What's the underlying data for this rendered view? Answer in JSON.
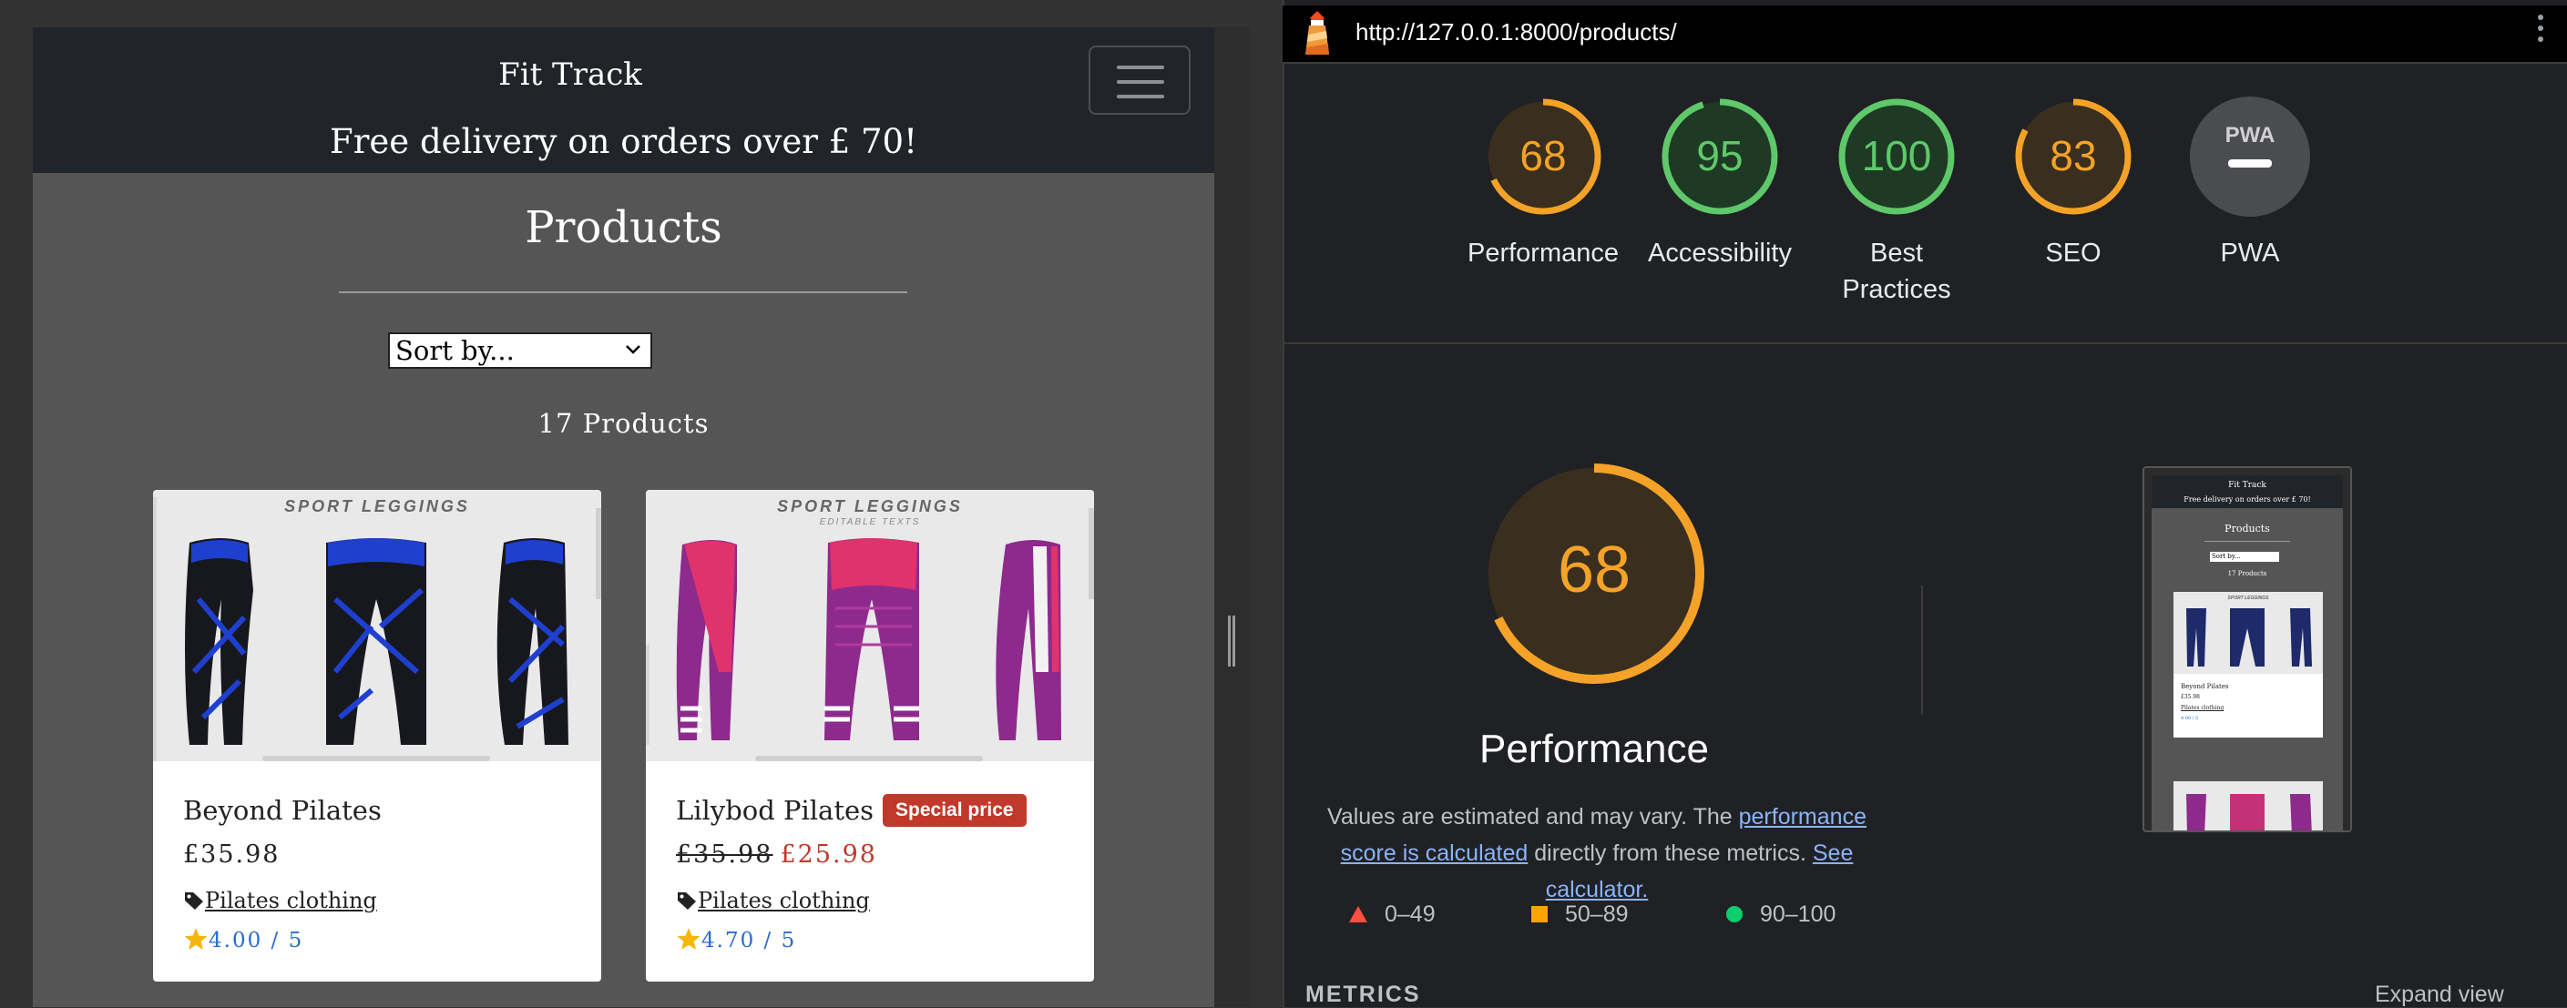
{
  "site": {
    "brand": "Fit Track",
    "delivery_banner": "Free delivery on orders over £ 70!",
    "page_title": "Products",
    "sort_placeholder": "Sort by...",
    "product_count": "17 Products",
    "products": [
      {
        "name": "Beyond Pilates",
        "banner": "SPORT LEGGINGS",
        "banner_sub": "",
        "price": "£35.98",
        "old_price": "",
        "badge": "",
        "category": "Pilates clothing",
        "rating": "4.00 / 5",
        "color_primary": "#1f3fcf",
        "color_secondary": "#17181d"
      },
      {
        "name": "Lilybod Pilates",
        "banner": "SPORT LEGGINGS",
        "banner_sub": "EDITABLE TEXTS",
        "price": "£25.98",
        "old_price": "£35.98",
        "badge": "Special price",
        "category": "Pilates clothing",
        "rating": "4.70 / 5",
        "color_primary": "#8e2a8c",
        "color_secondary": "#e0336d"
      }
    ]
  },
  "lighthouse": {
    "url": "http://127.0.0.1:8000/products/",
    "gauges": [
      {
        "label": "Performance",
        "score": "68",
        "value": 68,
        "color": "#f4a328"
      },
      {
        "label": "Accessibility",
        "score": "95",
        "value": 95,
        "color": "#5fc86a"
      },
      {
        "label": "Best Practices",
        "score": "100",
        "value": 100,
        "color": "#5fc86a"
      },
      {
        "label": "SEO",
        "score": "83",
        "value": 83,
        "color": "#f4a328"
      },
      {
        "label": "PWA",
        "score": "",
        "value": 0,
        "color": "#9aa0a6"
      }
    ],
    "big_score": "68",
    "big_score_value": 68,
    "big_label": "Performance",
    "estimate_pre": "Values are estimated and may vary. The ",
    "estimate_link": "performance score is calculated",
    "estimate_mid": " directly from these metrics. ",
    "calculator_link": "See calculator.",
    "legend": [
      {
        "shape": "triangle",
        "range": "0–49",
        "color": "#ff4e42"
      },
      {
        "shape": "square",
        "range": "50–89",
        "color": "#ffa400"
      },
      {
        "shape": "circle",
        "range": "90–100",
        "color": "#0cce6b"
      }
    ],
    "metrics_heading": "METRICS",
    "expand_view": "Expand view",
    "thumbnail": {
      "brand": "Fit Track",
      "delivery": "Free delivery on orders over £ 70!",
      "title": "Products",
      "sort": "Sort by...",
      "count": "17 Products",
      "banner": "SPORT LEGGINGS",
      "product": "Beyond Pilates",
      "price": "£35.98",
      "category": "Pilates clothing",
      "rating": "4.00 / 5"
    }
  }
}
